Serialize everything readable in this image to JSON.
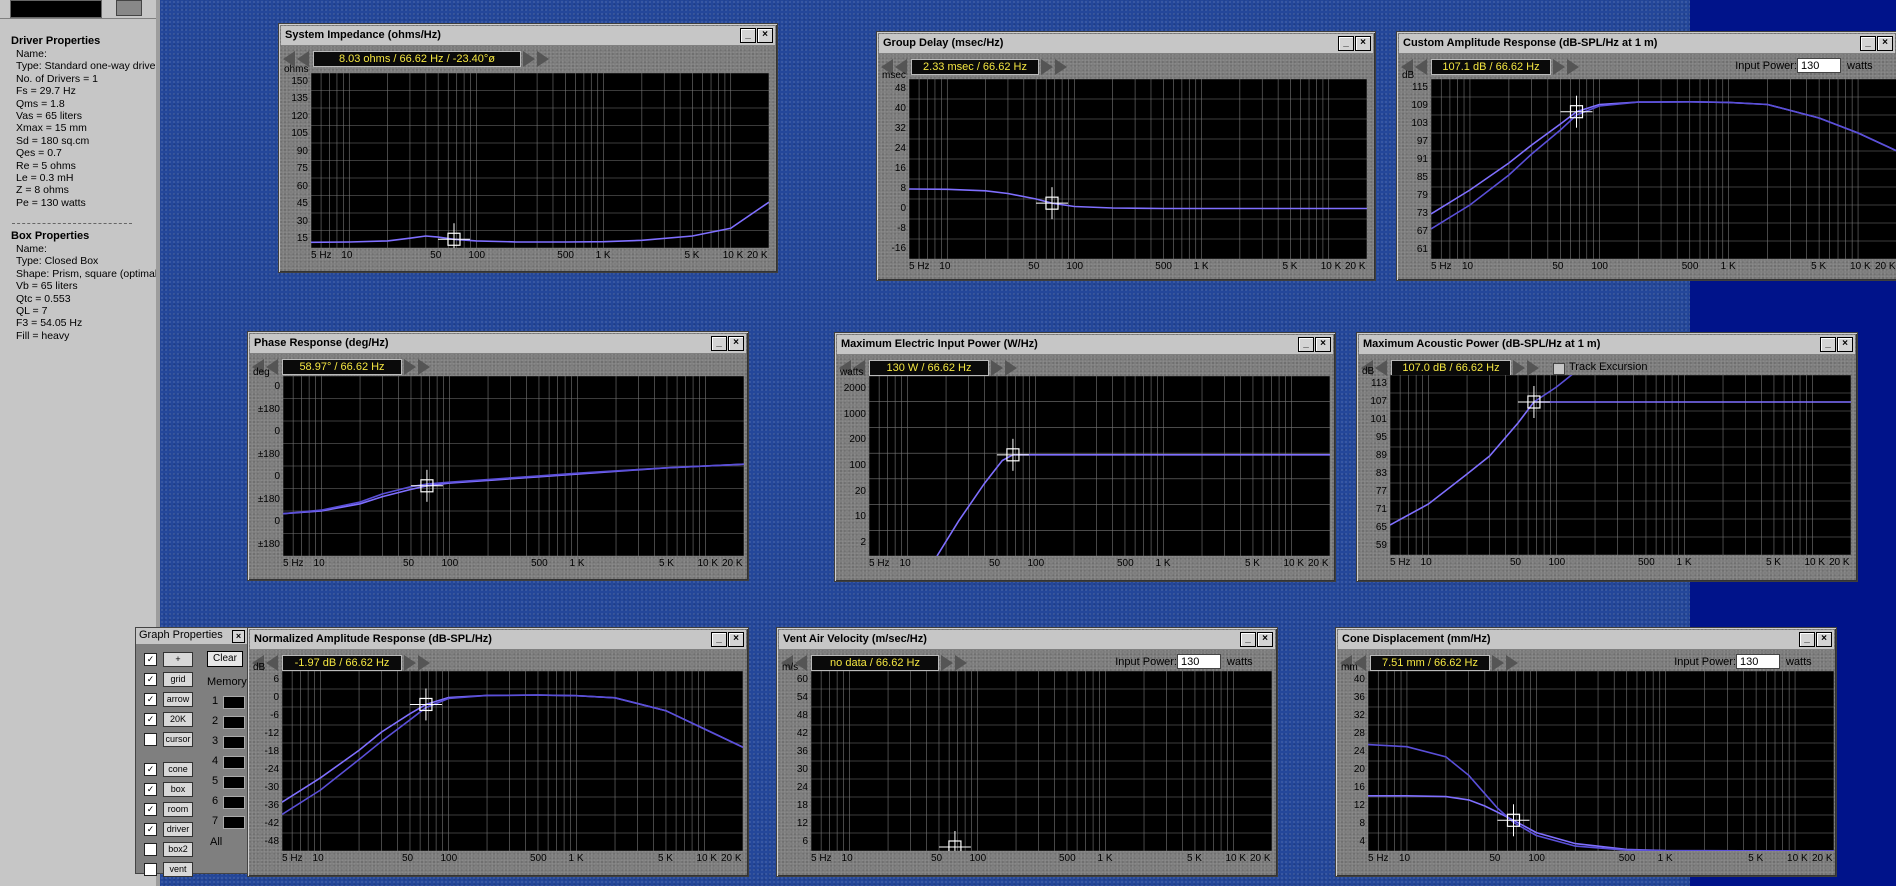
{
  "left_panel": {
    "driver_heading": "Driver Properties",
    "driver_lines": [
      "Name:",
      "Type: Standard one-way drive",
      "No. of Drivers = 1",
      "Fs = 29.7 Hz",
      "Qms = 1.8",
      "Vas = 65 liters",
      "Xmax = 15 mm",
      "Sd = 180 sq.cm",
      "Qes = 0.7",
      "Re = 5 ohms",
      "Le = 0.3 mH",
      "Z = 8 ohms",
      "Pe = 130 watts"
    ],
    "box_heading": "Box Properties",
    "box_lines": [
      "Name:",
      "Type: Closed Box",
      "Shape: Prism, square (optimal)",
      "Vb = 65 liters",
      "Qtc = 0.553",
      "QL = 7",
      "F3 = 54.05 Hz",
      "Fill = heavy"
    ]
  },
  "graph_properties": {
    "title": "Graph Properties",
    "close": "×",
    "clear": "Clear",
    "memory_label": "Memory",
    "memory_slots": [
      "1",
      "2",
      "3",
      "4",
      "5",
      "6",
      "7"
    ],
    "all_label": "All",
    "icons": [
      "+",
      "grid",
      "arrow",
      "20K",
      "cursor",
      "cone",
      "box",
      "room",
      "driver",
      "box2",
      "vent",
      "cone2",
      "label"
    ]
  },
  "x_ticks": [
    "5 Hz",
    "10",
    "50",
    "100",
    "500",
    "1 K",
    "5 K",
    "10 K",
    "20 K"
  ],
  "windows": [
    {
      "id": "imp",
      "title": "System Impedance (ohms/Hz)",
      "readout": "8.03 ohms / 66.62 Hz / -23.40°ø",
      "unit": "ohms",
      "yticks": [
        "150",
        "135",
        "120",
        "105",
        "90",
        "75",
        "60",
        "45",
        "30",
        "15"
      ],
      "input_power": null,
      "track": null
    },
    {
      "id": "gd",
      "title": "Group Delay (msec/Hz)",
      "readout": "2.33 msec / 66.62 Hz",
      "unit": "msec",
      "yticks": [
        "48",
        "40",
        "32",
        "24",
        "16",
        "8",
        "0",
        "-8",
        "-16"
      ],
      "input_power": null,
      "track": null
    },
    {
      "id": "car",
      "title": "Custom Amplitude Response (dB-SPL/Hz at 1 m)",
      "readout": "107.1 dB / 66.62 Hz",
      "unit": "dB",
      "yticks": [
        "115",
        "109",
        "103",
        "97",
        "91",
        "85",
        "79",
        "73",
        "67",
        "61"
      ],
      "input_power": {
        "label": "Input Power:",
        "value": "130",
        "units": "watts"
      },
      "track": null
    },
    {
      "id": "ph",
      "title": "Phase Response (deg/Hz)",
      "readout": "58.97° / 66.62 Hz",
      "unit": "deg",
      "yticks": [
        "0",
        "±180",
        "0",
        "±180",
        "0",
        "±180",
        "0",
        "±180"
      ],
      "input_power": null,
      "track": null
    },
    {
      "id": "mep",
      "title": "Maximum Electric Input Power (W/Hz)",
      "readout": "130 W / 66.62 Hz",
      "unit": "watts",
      "yticks": [
        "2000",
        "1000",
        "200",
        "100",
        "20",
        "10",
        "2"
      ],
      "input_power": null,
      "track": null
    },
    {
      "id": "map",
      "title": "Maximum Acoustic Power (dB-SPL/Hz at 1 m)",
      "readout": "107.0 dB / 66.62 Hz",
      "unit": "dB",
      "yticks": [
        "113",
        "107",
        "101",
        "95",
        "89",
        "83",
        "77",
        "71",
        "65",
        "59"
      ],
      "input_power": null,
      "track": {
        "label": "Track Excursion"
      }
    },
    {
      "id": "nar",
      "title": "Normalized Amplitude Response (dB-SPL/Hz)",
      "readout": "-1.97 dB / 66.62 Hz",
      "unit": "dB",
      "yticks": [
        "6",
        "0",
        "-6",
        "-12",
        "-18",
        "-24",
        "-30",
        "-36",
        "-42",
        "-48"
      ],
      "input_power": null,
      "track": null
    },
    {
      "id": "vav",
      "title": "Vent Air Velocity (m/sec/Hz)",
      "readout": "no data / 66.62 Hz",
      "unit": "m/s",
      "yticks": [
        "60",
        "54",
        "48",
        "42",
        "36",
        "30",
        "24",
        "18",
        "12",
        "6"
      ],
      "input_power": {
        "label": "Input Power:",
        "value": "130",
        "units": "watts"
      },
      "track": null
    },
    {
      "id": "cd",
      "title": "Cone Displacement (mm/Hz)",
      "readout": "7.51 mm / 66.62 Hz",
      "unit": "mm",
      "yticks": [
        "40",
        "36",
        "32",
        "28",
        "24",
        "20",
        "16",
        "12",
        "8",
        "4"
      ],
      "input_power": {
        "label": "Input Power:",
        "value": "130",
        "units": "watts"
      },
      "track": null
    }
  ],
  "chart_data": [
    {
      "type": "line",
      "title": "System Impedance (ohms/Hz)",
      "x_scale": "log",
      "xlim": [
        5,
        20000
      ],
      "ylim": [
        0,
        160
      ],
      "ylabel": "ohms",
      "series": [
        {
          "x": [
            5,
            10,
            20,
            30,
            40,
            50,
            66.62,
            100,
            200,
            500,
            1000,
            2000,
            5000,
            10000,
            20000
          ],
          "y": [
            5.2,
            5.5,
            6.5,
            9,
            11,
            10,
            8,
            6.5,
            5.6,
            5.5,
            5.8,
            7,
            11,
            18,
            42
          ]
        }
      ]
    },
    {
      "type": "line",
      "title": "Group Delay (msec/Hz)",
      "x_scale": "log",
      "xlim": [
        5,
        20000
      ],
      "ylim": [
        -20,
        52
      ],
      "ylabel": "msec",
      "series": [
        {
          "x": [
            5,
            10,
            20,
            30,
            50,
            66.62,
            100,
            200,
            500,
            1000,
            5000,
            20000
          ],
          "y": [
            8,
            7.9,
            7.3,
            6.2,
            4,
            2.33,
            1,
            0.4,
            0.2,
            0.2,
            0.2,
            0.2
          ]
        }
      ]
    },
    {
      "type": "line",
      "title": "Custom Amplitude Response (dB-SPL/Hz at 1 m)",
      "x_scale": "log",
      "xlim": [
        5,
        20000
      ],
      "ylim": [
        58,
        118
      ],
      "ylabel": "dB",
      "series": [
        {
          "x": [
            5,
            10,
            20,
            30,
            50,
            66.62,
            100,
            200,
            500,
            1000,
            2000,
            5000,
            10000,
            20000
          ],
          "y": [
            73,
            81,
            90,
            96,
            103,
            107.1,
            109.5,
            110.3,
            110.4,
            110.2,
            109.5,
            105,
            100,
            94
          ]
        },
        {
          "x": [
            5,
            10,
            20,
            30,
            50,
            66.62,
            100,
            200,
            500,
            1000,
            2000,
            5000,
            10000,
            20000
          ],
          "y": [
            68,
            76,
            86,
            93,
            101,
            106,
            109,
            110.3,
            110.4,
            110.2,
            109.5,
            105,
            100,
            94
          ]
        }
      ]
    },
    {
      "type": "line",
      "title": "Phase Response (deg/Hz)",
      "x_scale": "log",
      "xlim": [
        5,
        20000
      ],
      "ylabel": "deg",
      "series": [
        {
          "x": [
            5,
            10,
            20,
            30,
            50,
            66.62,
            100,
            200,
            500,
            1000,
            5000,
            20000
          ],
          "y": [
            0.235,
            0.25,
            0.29,
            0.33,
            0.37,
            0.39,
            0.405,
            0.42,
            0.44,
            0.455,
            0.49,
            0.51
          ]
        },
        {
          "x": [
            5,
            10,
            20,
            30,
            50,
            66.62,
            100,
            200,
            500,
            1000,
            5000,
            20000
          ],
          "y": [
            0.235,
            0.255,
            0.3,
            0.345,
            0.385,
            0.4,
            0.41,
            0.425,
            0.445,
            0.46,
            0.49,
            0.51
          ]
        }
      ]
    },
    {
      "type": "line",
      "title": "Maximum Electric Input Power (W/Hz)",
      "x_scale": "log",
      "y_scale": "log",
      "xlim": [
        5,
        20000
      ],
      "ylim": [
        1.2,
        5000
      ],
      "ylabel": "watts",
      "series": [
        {
          "x": [
            17,
            25,
            40,
            55,
            66.62,
            100,
            1000,
            10000,
            20000
          ],
          "y": [
            1.2,
            6,
            35,
            100,
            130,
            130,
            130,
            130,
            130
          ]
        }
      ]
    },
    {
      "type": "line",
      "title": "Maximum Acoustic Power (dB-SPL/Hz at 1 m)",
      "x_scale": "log",
      "xlim": [
        5,
        20000
      ],
      "ylim": [
        56,
        116
      ],
      "ylabel": "dB",
      "series": [
        {
          "x": [
            5,
            10,
            20,
            30,
            50,
            66.62,
            100,
            1000,
            20000
          ],
          "y": [
            66,
            73,
            83,
            89,
            100,
            107,
            107,
            107,
            107
          ]
        },
        {
          "x": [
            66.62,
            100,
            150
          ],
          "y": [
            107,
            112,
            118
          ]
        }
      ]
    },
    {
      "type": "line",
      "title": "Normalized Amplitude Response (dB-SPL/Hz)",
      "x_scale": "log",
      "xlim": [
        5,
        20000
      ],
      "ylim": [
        -50,
        9
      ],
      "ylabel": "dB",
      "series": [
        {
          "x": [
            5,
            10,
            20,
            30,
            50,
            66.62,
            100,
            200,
            500,
            1000,
            2000,
            5000,
            10000,
            20000
          ],
          "y": [
            -34,
            -26,
            -17,
            -11,
            -5,
            -1.97,
            0.3,
            1,
            1.1,
            0.9,
            0.2,
            -4,
            -10,
            -16
          ]
        },
        {
          "x": [
            5,
            10,
            20,
            30,
            50,
            66.62,
            100,
            200,
            500,
            1000,
            2000,
            5000,
            10000,
            20000
          ],
          "y": [
            -38,
            -30,
            -20,
            -14,
            -7,
            -3,
            0,
            1,
            1.1,
            0.9,
            0.2,
            -4,
            -10,
            -16
          ]
        }
      ]
    },
    {
      "type": "line",
      "title": "Vent Air Velocity (m/sec/Hz)",
      "x_scale": "log",
      "xlim": [
        5,
        20000
      ],
      "ylim": [
        0,
        64
      ],
      "ylabel": "m/s",
      "series": []
    },
    {
      "type": "line",
      "title": "Cone Displacement (mm/Hz)",
      "x_scale": "log",
      "xlim": [
        5,
        20000
      ],
      "ylim": [
        0,
        44
      ],
      "ylabel": "mm",
      "series": [
        {
          "x": [
            5,
            10,
            20,
            30,
            40,
            50,
            66.62,
            100,
            200,
            500,
            1000,
            20000
          ],
          "y": [
            13.5,
            13.5,
            13.3,
            12.5,
            11,
            9.5,
            7.51,
            4.5,
            1.8,
            0.4,
            0.1,
            0
          ]
        },
        {
          "x": [
            5,
            10,
            20,
            30,
            40,
            50,
            66.62,
            100,
            200,
            500,
            1000,
            20000
          ],
          "y": [
            26,
            25.5,
            23,
            18.5,
            14,
            10.5,
            7,
            3.8,
            1.2,
            0.2,
            0.05,
            0
          ]
        }
      ]
    }
  ],
  "colors": {
    "trace": "#7f6fff",
    "trace2": "#5a4fd8",
    "grid": "#777777",
    "readout_text": "#f5e742",
    "desktop": "#24479a",
    "desktop_right": "#00138a"
  }
}
